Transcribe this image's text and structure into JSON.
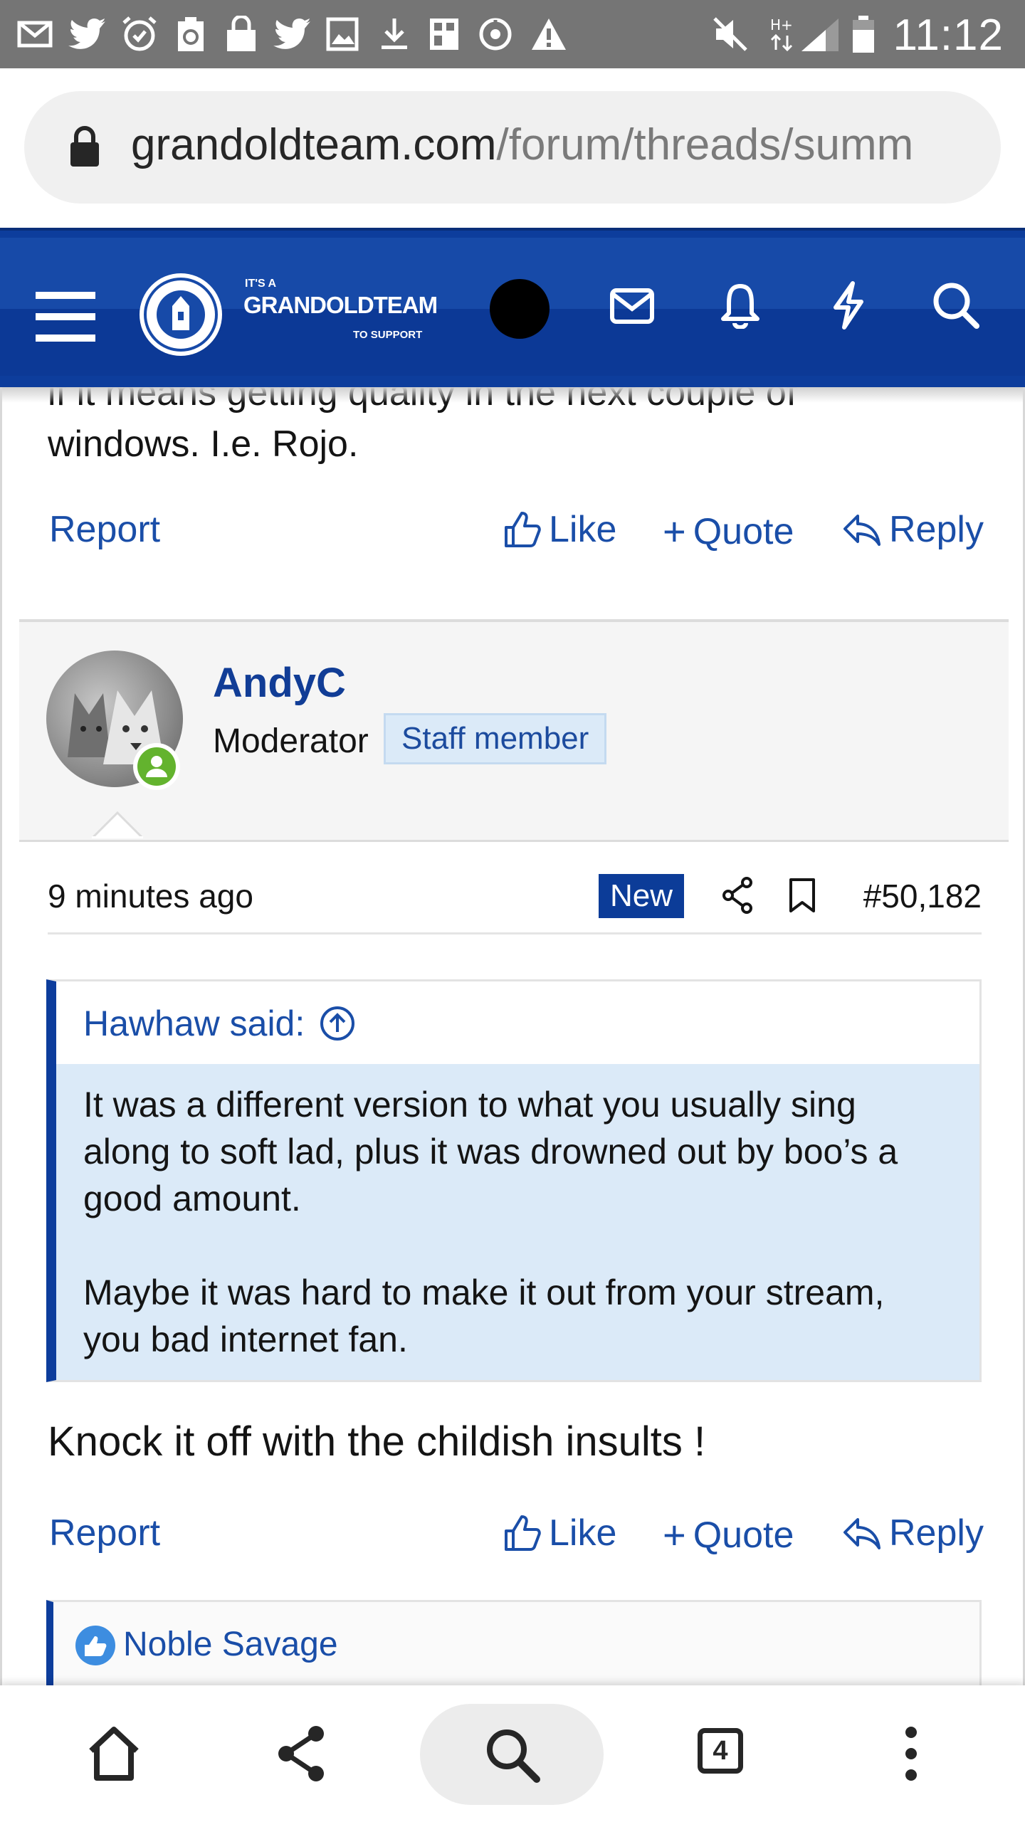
{
  "status_bar": {
    "time": "11:12",
    "left_icons": [
      "mail-icon",
      "twitter-icon",
      "alarm-icon",
      "clipboard-icon",
      "lock-bag-icon",
      "twitter-icon",
      "image-icon",
      "download-icon",
      "grid-icon",
      "sync-icon",
      "warning-icon"
    ],
    "right_icons": [
      "mute-icon",
      "hplus-data-icon",
      "signal-icon",
      "battery-icon"
    ]
  },
  "browser": {
    "url_domain": "grandoldteam.com",
    "url_path": "/forum/threads/summ",
    "tab_count": "4"
  },
  "site_header": {
    "logo_small_top": "IT'S A",
    "logo_main": "GRANDOLDTEAM",
    "logo_small_bottom": "TO SUPPORT"
  },
  "previous_post": {
    "text_cut": "if it means getting quality in the next couple of",
    "text_line": "windows. I.e. Rojo.",
    "actions": {
      "report": "Report",
      "like": "Like",
      "quote": "Quote",
      "reply": "Reply"
    }
  },
  "post": {
    "username": "AndyC",
    "user_title": "Moderator",
    "staff_badge": "Staff member",
    "time": "9 minutes ago",
    "new_badge": "New",
    "post_number": "#50,182",
    "quote": {
      "author": "Hawhaw said:",
      "line1": "It was a different version to what you usually sing",
      "line2": "along to soft lad, plus it was drowned out by boo’s a",
      "line3": "good amount.",
      "line4": "Maybe it was hard to make it out from your stream,",
      "line5": "you bad internet fan."
    },
    "body": "Knock it off with the childish insults !",
    "actions": {
      "report": "Report",
      "like": "Like",
      "quote": "Quote",
      "reply": "Reply"
    },
    "reactions_user": "Noble Savage"
  },
  "colors": {
    "brand_blue": "#0d3d9c",
    "link_blue": "#1a4ea8",
    "quote_bg": "#dbeaf8",
    "online_green": "#63b32e"
  }
}
